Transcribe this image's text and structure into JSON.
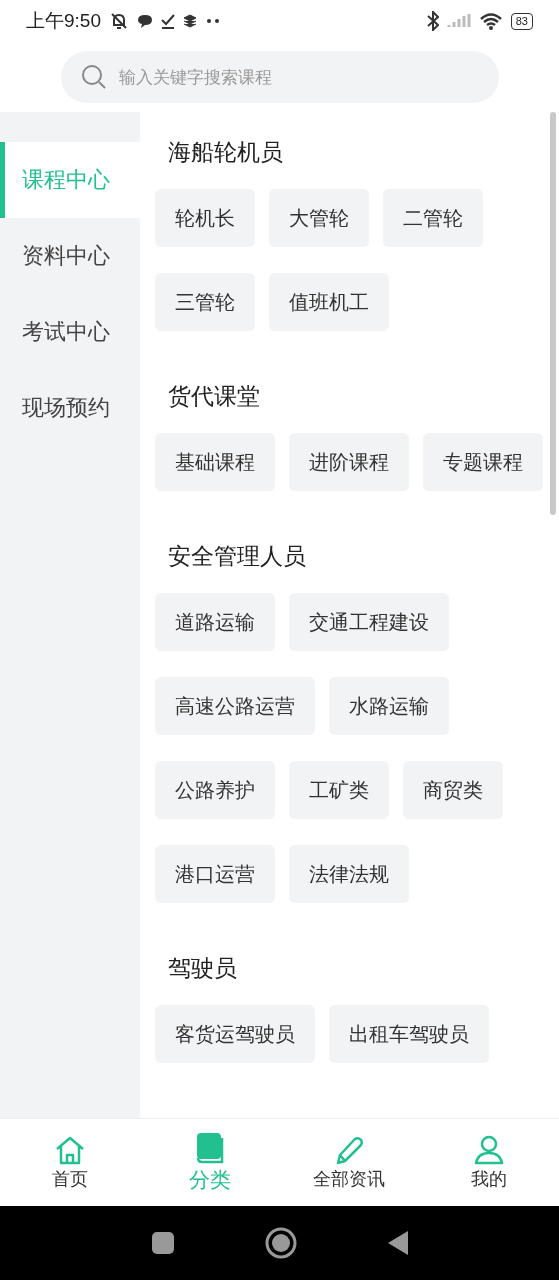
{
  "status_bar": {
    "time": "上午9:50",
    "battery": "83"
  },
  "search": {
    "placeholder": "输入关键字搜索课程"
  },
  "sidebar": {
    "items": [
      {
        "label": "课程中心",
        "selected": true
      },
      {
        "label": "资料中心",
        "selected": false
      },
      {
        "label": "考试中心",
        "selected": false
      },
      {
        "label": "现场预约",
        "selected": false
      }
    ]
  },
  "sections": [
    {
      "title": "海船轮机员",
      "chips": [
        "轮机长",
        "大管轮",
        "二管轮",
        "三管轮",
        "值班机工"
      ]
    },
    {
      "title": "货代课堂",
      "chips": [
        "基础课程",
        "进阶课程",
        "专题课程"
      ]
    },
    {
      "title": "安全管理人员",
      "chips": [
        "道路运输",
        "交通工程建设",
        "高速公路运营",
        "水路运输",
        "公路养护",
        "工矿类",
        "商贸类",
        "港口运营",
        "法律法规"
      ]
    },
    {
      "title": "驾驶员",
      "chips": [
        "客货运驾驶员",
        "出租车驾驶员"
      ]
    }
  ],
  "tabs": [
    {
      "label": "首页",
      "kind": "home",
      "selected": false
    },
    {
      "label": "分类",
      "kind": "category",
      "selected": true
    },
    {
      "label": "全部资讯",
      "kind": "news",
      "selected": false
    },
    {
      "label": "我的",
      "kind": "profile",
      "selected": false
    }
  ]
}
